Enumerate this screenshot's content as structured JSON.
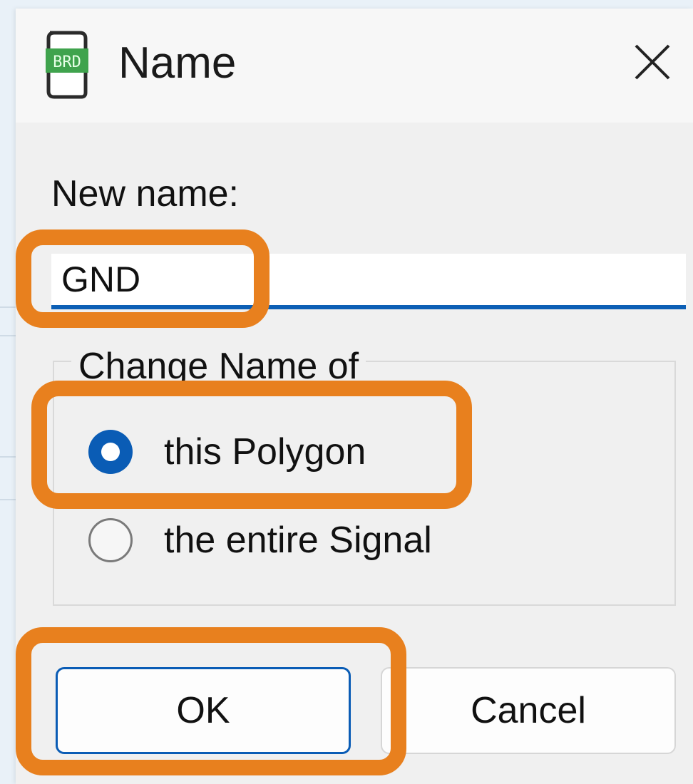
{
  "dialog": {
    "title": "Name",
    "icon_name": "brd-file-icon",
    "icon_text": "BRD",
    "close_icon": "close-icon",
    "close_glyph": "✕"
  },
  "form": {
    "new_name_label": "New name:",
    "new_name_value": "GND"
  },
  "change_group": {
    "legend": "Change Name of",
    "options": [
      {
        "label": "this Polygon",
        "selected": true
      },
      {
        "label": "the entire Signal",
        "selected": false
      }
    ]
  },
  "buttons": {
    "ok_label": "OK",
    "cancel_label": "Cancel"
  },
  "colors": {
    "accent": "#0a5cb5",
    "highlight": "#e8801e",
    "icon_green": "#3fa34d"
  }
}
